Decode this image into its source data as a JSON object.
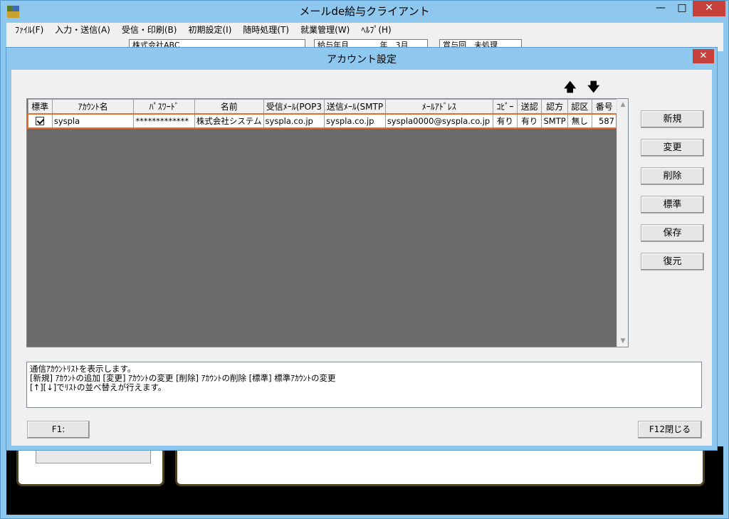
{
  "main_window": {
    "title": "メールde給与クライアント",
    "controls": {
      "minimize": "—",
      "maximize": "□",
      "close": "✕"
    }
  },
  "menu": [
    "ﾌｧｲﾙ(F)",
    "入力・送信(A)",
    "受信・印刷(B)",
    "初期設定(I)",
    "随時処理(T)",
    "就業管理(W)",
    "ﾍﾙﾌﾟ(H)"
  ],
  "toolbar": {
    "company": "株式会社ABC",
    "period_label": "給与年月",
    "period_suffix": "年　3月",
    "bonus_label": "賞与回　未処理"
  },
  "dialog": {
    "title": "アカウント設定",
    "close": "✕",
    "move_up": "🡅",
    "move_down": "🡇",
    "columns": [
      "標準",
      "ｱｶｳﾝﾄ名",
      "ﾊﾟｽﾜｰﾄﾞ",
      "名前",
      "受信ﾒｰﾙ(POP3",
      "送信ﾒｰﾙ(SMTP",
      "ﾒｰﾙｱﾄﾞﾚｽ",
      "ｺﾋﾟｰ",
      "送認",
      "認方",
      "認区",
      "番号"
    ],
    "rows": [
      {
        "default": true,
        "account": "syspla",
        "password": "*************",
        "name": "株式会社システム",
        "pop": "syspla.co.jp",
        "smtp": "syspla.co.jp",
        "email": "syspla0000@syspla.co.jp",
        "copy": "有り",
        "send_auth": "有り",
        "auth_method": "SMTP",
        "auth_type": "無し",
        "number": "587"
      }
    ],
    "buttons": {
      "new": "新規",
      "change": "変更",
      "delete": "削除",
      "default": "標準",
      "save": "保存",
      "restore": "復元"
    },
    "info_lines": [
      "通信ｱｶｳﾝﾄﾘｽﾄを表示します。",
      "[新規] ｱｶｳﾝﾄの追加 [変更] ｱｶｳﾝﾄの変更 [削除] ｱｶｳﾝﾄの削除 [標準] 標準ｱｶｳﾝﾄの変更",
      "[↑][↓]でﾘｽﾄの並べ替えが行えます。"
    ],
    "f1_label": "F1:",
    "f12_label": "F12閉じる"
  },
  "colors": {
    "window_frame": "#8ec8ee",
    "close_red": "#c7413c",
    "selection_border": "#e07030",
    "grid_empty": "#6b6b6b"
  }
}
